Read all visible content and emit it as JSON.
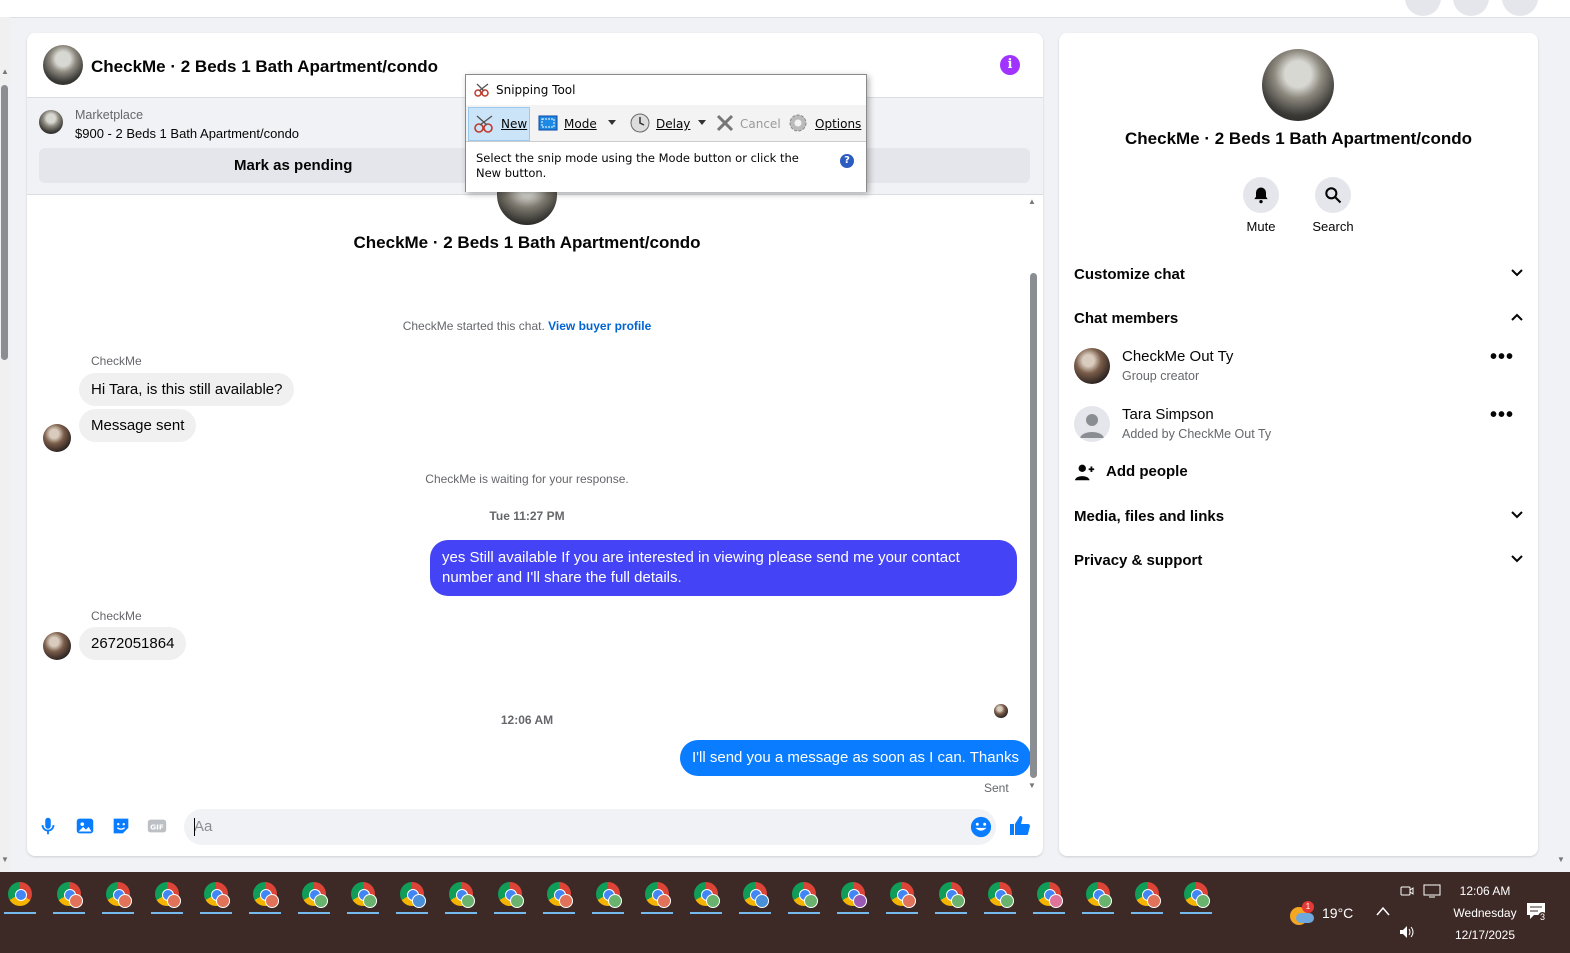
{
  "chat_header": {
    "title": "CheckMe · 2 Beds 1 Bath Apartment/condo"
  },
  "listing": {
    "source": "Marketplace",
    "price_title": "$900 - 2 Beds 1 Bath Apartment/condo",
    "pending_label": "Mark as pending"
  },
  "conversation": {
    "title": "CheckMe · 2 Beds 1 Bath Apartment/condo",
    "started_prefix": "CheckMe started this chat.",
    "buyer_link": "View buyer profile",
    "sender1": "CheckMe",
    "msg1": "Hi Tara, is this still available?",
    "msg2": "Message sent",
    "waiting": "CheckMe is waiting for your response.",
    "ts1": "Tue 11:27 PM",
    "out1": "yes Still available If you are interested in viewing please send me your contact number and I'll share the full details.",
    "sender2": "CheckMe",
    "msg3": "2672051864",
    "ts2": "12:06 AM",
    "out2": "I'll send you a message as soon as I can. Thanks",
    "sent_status": "Sent"
  },
  "composer": {
    "placeholder": "Aa"
  },
  "panel": {
    "name": "CheckMe · 2 Beds 1 Bath Apartment/condo",
    "actions": [
      {
        "label": "Mute",
        "icon": "bell-icon"
      },
      {
        "label": "Search",
        "icon": "search-icon"
      }
    ],
    "customize": "Customize chat",
    "members_title": "Chat members",
    "members": [
      {
        "name": "CheckMe Out Ty",
        "sub": "Group creator"
      },
      {
        "name": "Tara Simpson",
        "sub": "Added by CheckMe Out Ty"
      }
    ],
    "add_people": "Add people",
    "media": "Media, files and links",
    "privacy": "Privacy & support"
  },
  "snipping_tool": {
    "title": "Snipping Tool",
    "new": "New",
    "mode": "Mode",
    "delay": "Delay",
    "cancel": "Cancel",
    "options": "Options",
    "help": "Select the snip mode using the Mode button or click the New button."
  },
  "taskbar": {
    "temperature": "19°C",
    "time": "12:06 AM",
    "day": "Wednesday",
    "date": "12/17/2025",
    "weather_badge": "1",
    "notif_count": "3"
  },
  "colors": {
    "accent": "#0a7cff",
    "outgoing": "#4443f5",
    "info": "#a033ff",
    "taskbar": "#3d2a26"
  }
}
